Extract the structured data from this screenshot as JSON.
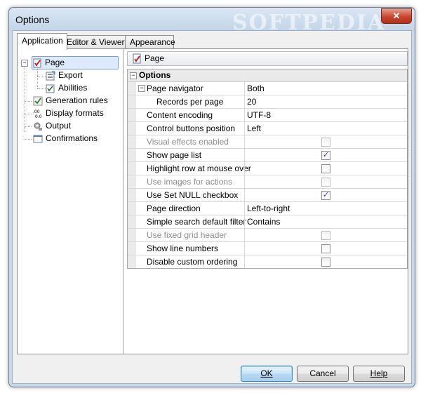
{
  "window": {
    "title": "Options",
    "watermark": "SOFTPEDIA",
    "close_glyph": "✕"
  },
  "tabs": [
    {
      "label": "Application",
      "active": true
    },
    {
      "label": "Editor & Viewers",
      "active": false
    },
    {
      "label": "Appearance",
      "active": false
    }
  ],
  "tree": {
    "items": [
      {
        "label": "Page",
        "icon": "page-icon",
        "selected": true
      },
      {
        "label": "Export",
        "icon": "export-icon"
      },
      {
        "label": "Abilities",
        "icon": "abilities-icon"
      },
      {
        "label": "Generation rules",
        "icon": "generation-rules-icon"
      },
      {
        "label": "Display formats",
        "icon": "display-formats-icon"
      },
      {
        "label": "Output",
        "icon": "output-icon"
      },
      {
        "label": "Confirmations",
        "icon": "confirmations-icon"
      }
    ],
    "expander_glyph": "−"
  },
  "panel": {
    "header": "Page"
  },
  "grid": {
    "category": "Options",
    "rows": [
      {
        "name": "Page navigator",
        "value": "Both",
        "expander": true
      },
      {
        "name": "Records per page",
        "value": "20",
        "sub": true
      },
      {
        "name": "Content encoding",
        "value": "UTF-8"
      },
      {
        "name": "Control buttons position",
        "value": "Left"
      },
      {
        "name": "Visual effects enabled",
        "checkbox": true,
        "checked": false,
        "disabled": true
      },
      {
        "name": "Show page list",
        "checkbox": true,
        "checked": true
      },
      {
        "name": "Highlight row at mouse over",
        "checkbox": true,
        "checked": false
      },
      {
        "name": "Use images for actions",
        "checkbox": true,
        "checked": false,
        "disabled": true
      },
      {
        "name": "Use Set NULL checkbox",
        "checkbox": true,
        "checked": true
      },
      {
        "name": "Page direction",
        "value": "Left-to-right"
      },
      {
        "name": "Simple search default filter",
        "value": "Contains"
      },
      {
        "name": "Use fixed grid header",
        "checkbox": true,
        "checked": false,
        "disabled": true
      },
      {
        "name": "Show line numbers",
        "checkbox": true,
        "checked": false
      },
      {
        "name": "Disable custom ordering",
        "checkbox": true,
        "checked": false
      }
    ],
    "check_glyph": "✓"
  },
  "buttons": {
    "ok": {
      "label": "OK",
      "underline": "O"
    },
    "cancel": {
      "label": "Cancel"
    },
    "help": {
      "label": "Help",
      "underline": "H"
    }
  }
}
